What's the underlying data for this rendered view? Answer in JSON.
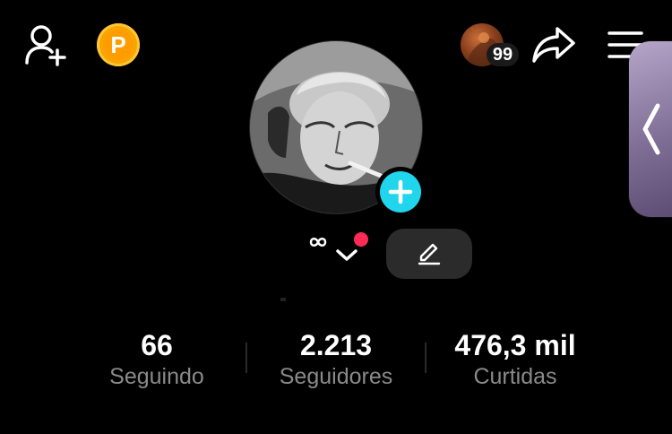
{
  "header": {
    "icons": [
      "add-user-icon",
      "coin-icon",
      "share-icon",
      "menu-icon"
    ],
    "coin_letter": "P",
    "visitor_count": "99"
  },
  "profile": {
    "handle_glyph": "ꝏ",
    "accent_color": "#20d5ec",
    "notification_color": "#fe2c55"
  },
  "stats": [
    {
      "value": "66",
      "label": "Seguindo"
    },
    {
      "value": "2.213",
      "label": "Seguidores"
    },
    {
      "value": "476,3 mil",
      "label": "Curtidas"
    }
  ]
}
